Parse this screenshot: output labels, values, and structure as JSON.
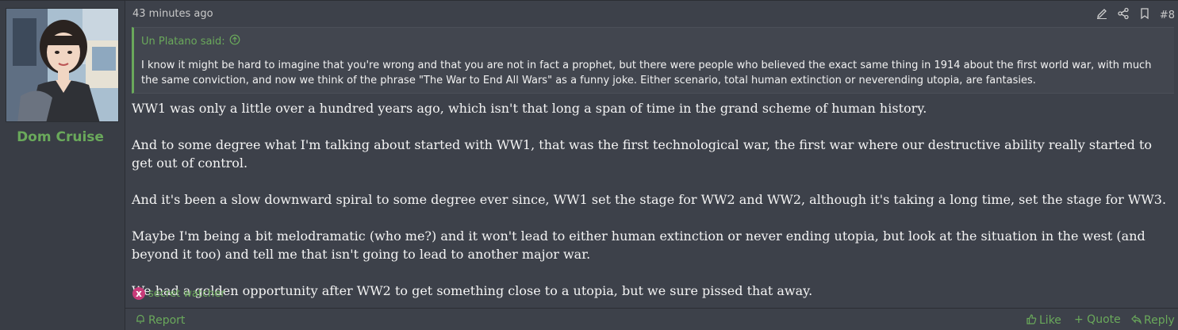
{
  "user": {
    "name": "Dom Cruise"
  },
  "post": {
    "timestamp": "43 minutes ago",
    "number": "#8",
    "quote": {
      "author": "Un Platano said:",
      "text": "I know it might be hard to imagine that you're wrong and that you are not in fact a prophet, but there were people who believed the exact same thing in 1914 about the first world war, with much the same conviction, and now we think of the phrase \"The War to End All Wars\" as a funny joke. Either scenario, total human extinction or neverending utopia, are fantasies."
    },
    "paragraphs": [
      "WW1 was only a little over a hundred years ago, which isn't that long a span of time in the grand scheme of human history.",
      "And to some degree what I'm talking about started with WW1, that was the first technological war, the first war where our destructive ability really started to get out of control.",
      "And it's been a slow downward spiral to some degree ever since, WW1 set the stage for WW2 and WW2, although it's taking a long time, set the stage for WW3.",
      "Maybe I'm being a bit melodramatic (who me?) and it won't lead to either human extinction or never ending utopia, but look at the situation in the west (and beyond it too) and tell me that isn't going to lead to another major war.",
      "We had a golden opportunity after WW2 to get something close to a utopia, but we sure pissed that away."
    ],
    "reaction": {
      "icon": "x",
      "user": "secret watcher"
    }
  },
  "footer": {
    "report": "Report",
    "like": "Like",
    "quote": "+ Quote",
    "reply": "Reply"
  },
  "colors": {
    "accent": "#6aa95b",
    "background": "#3d414a",
    "reaction": "#c73b79"
  }
}
